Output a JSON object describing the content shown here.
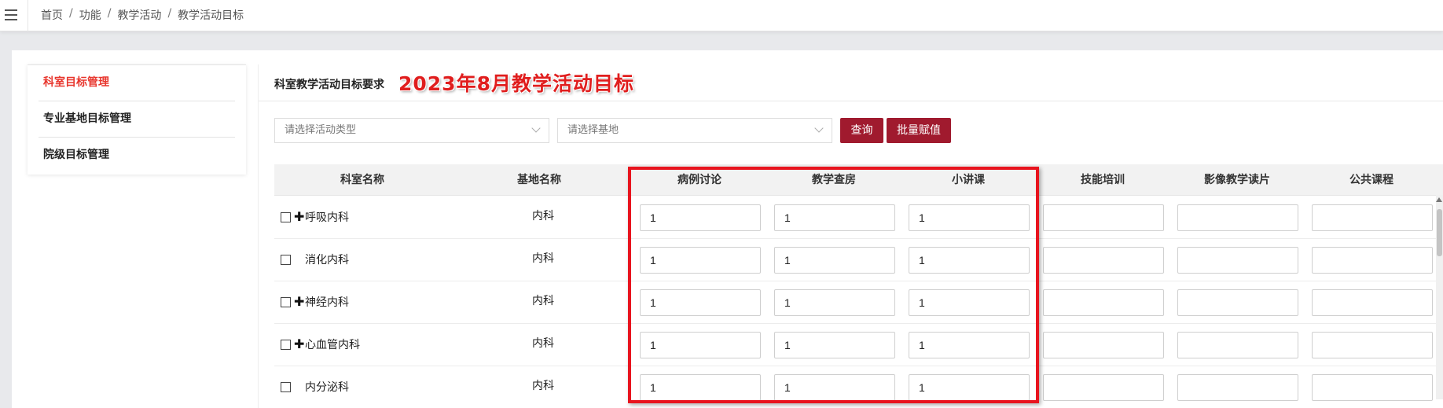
{
  "breadcrumb": [
    "首页",
    "功能",
    "教学活动",
    "教学活动目标"
  ],
  "sidebar": {
    "items": [
      {
        "label": "科室目标管理",
        "active": true
      },
      {
        "label": "专业基地目标管理",
        "active": false
      },
      {
        "label": "院级目标管理",
        "active": false
      }
    ]
  },
  "main": {
    "title": "科室教学活动目标要求",
    "overlay_title": "2023年8月教学活动目标",
    "filters": {
      "activity_type_placeholder": "请选择活动类型",
      "base_placeholder": "请选择基地"
    },
    "buttons": {
      "query": "查询",
      "batch_assign": "批量赋值"
    }
  },
  "table": {
    "columns": [
      "科室名称",
      "基地名称",
      "病例讨论",
      "教学查房",
      "小讲课",
      "技能培训",
      "影像教学读片",
      "公共课程"
    ],
    "rows": [
      {
        "dept": "呼吸内科",
        "expandable": true,
        "base": "内科",
        "values": [
          "1",
          "1",
          "1",
          "",
          "",
          ""
        ]
      },
      {
        "dept": "消化内科",
        "expandable": false,
        "base": "内科",
        "values": [
          "1",
          "1",
          "1",
          "",
          "",
          ""
        ]
      },
      {
        "dept": "神经内科",
        "expandable": true,
        "base": "内科",
        "values": [
          "1",
          "1",
          "1",
          "",
          "",
          ""
        ]
      },
      {
        "dept": "心血管内科",
        "expandable": true,
        "base": "内科",
        "values": [
          "1",
          "1",
          "1",
          "",
          "",
          ""
        ]
      },
      {
        "dept": "内分泌科",
        "expandable": false,
        "base": "内科",
        "values": [
          "1",
          "1",
          "1",
          "",
          "",
          ""
        ]
      }
    ]
  },
  "colors": {
    "accent_button": "#a01a2e",
    "active_nav": "#e8362d",
    "highlight_box": "#e8141e"
  }
}
